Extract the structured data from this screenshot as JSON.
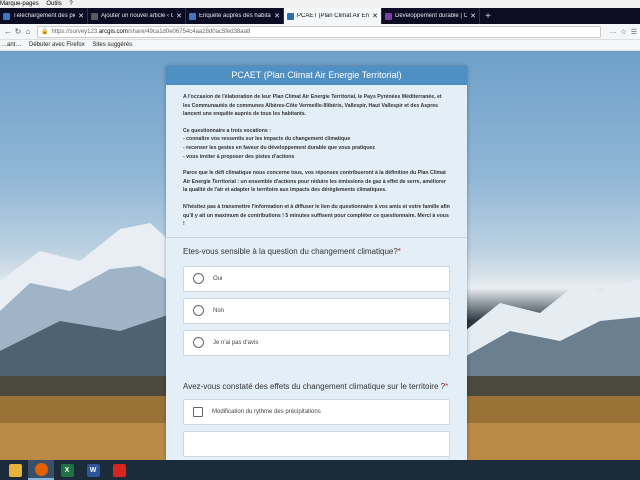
{
  "menubar": {
    "items": [
      "Marque-pages",
      "Outils",
      "?"
    ]
  },
  "tabs": [
    {
      "title": "Téléchargement des pièces jointes",
      "favicon_color": "#3a78c2"
    },
    {
      "title": "Ajouter un nouvel article ‹ CC Haut Vallespir",
      "favicon_color": "#5a5a5a"
    },
    {
      "title": "Enquête auprès des habitants du Pays",
      "favicon_color": "#3a78c2"
    },
    {
      "title": "PCAET (Plan Climat Air Energie Territorial)",
      "favicon_color": "#2a6fb0",
      "active": true
    },
    {
      "title": "Développement durable | CC Haut Vallespir",
      "favicon_color": "#7a3fa0"
    }
  ],
  "navbar": {
    "url_prefix": "https://survey123.",
    "url_domain": "arcgis.com",
    "url_suffix": "/share/49ca1d0e06754c4aa28d0ac5fed38aa8",
    "right_icons": [
      "…",
      "☆",
      "☰"
    ]
  },
  "bookmarks": {
    "items": [
      "…ant…",
      "Débuter avec Firefox",
      "Sites suggérés"
    ]
  },
  "survey": {
    "title": "PCAET (Plan Climat Air Energie Territorial)",
    "intro_paragraphs": [
      "A l'occasion de l'élaboration de leur Plan Climat Air Energie Territorial, le Pays Pyrénées Méditerranée, et les Communautés de communes Albères-Côte Vermeille-Illibéris, Vallespir, Haut Vallespir et des Aspres lancent une enquête auprès de tous les habitants.",
      "Ce questionnaire a trois vocations :\n- connaître vos ressentis sur les impacts du changement climatique\n- recenser les gestes en faveur du développement durable que vous pratiquez\n- vous inviter à proposer des pistes d'actions",
      "Parce que le défi climatique nous concerne tous, vos réponses contribueront à la définition du Plan Climat Air Energie Territorial : un ensemble d'actions pour réduire les émissions de gaz à effet de serre, améliorer la qualité de l'air et adapter le territoire aux impacts des dérèglements climatiques.",
      "N'hésitez pas à transmettre l'information et à diffuser le lien du questionnaire à vos amis et votre famille afin qu'il y ait un maximum de contributions ! 5 minutes suffisent pour compléter ce questionnaire. Merci à vous !"
    ],
    "q1": {
      "title": "Etes-vous sensible à la question du changement climatique?",
      "required_mark": "*",
      "options": [
        "Oui",
        "Non",
        "Je n'ai pas d'avis"
      ]
    },
    "q2": {
      "title": "Avez-vous constaté des effets du changement climatique sur le territoire ?",
      "required_mark": "*",
      "options": [
        "Modification du rythme des précipitations"
      ]
    }
  },
  "taskbar": {
    "items": [
      {
        "name": "explorer",
        "label": "",
        "color": "#e7b43a"
      },
      {
        "name": "firefox",
        "label": "",
        "color": "#e66000"
      },
      {
        "name": "excel",
        "label": "X",
        "color": "#1f7244"
      },
      {
        "name": "word",
        "label": "W",
        "color": "#2b579a"
      },
      {
        "name": "acrobat",
        "label": "",
        "color": "#d9251d"
      }
    ]
  }
}
